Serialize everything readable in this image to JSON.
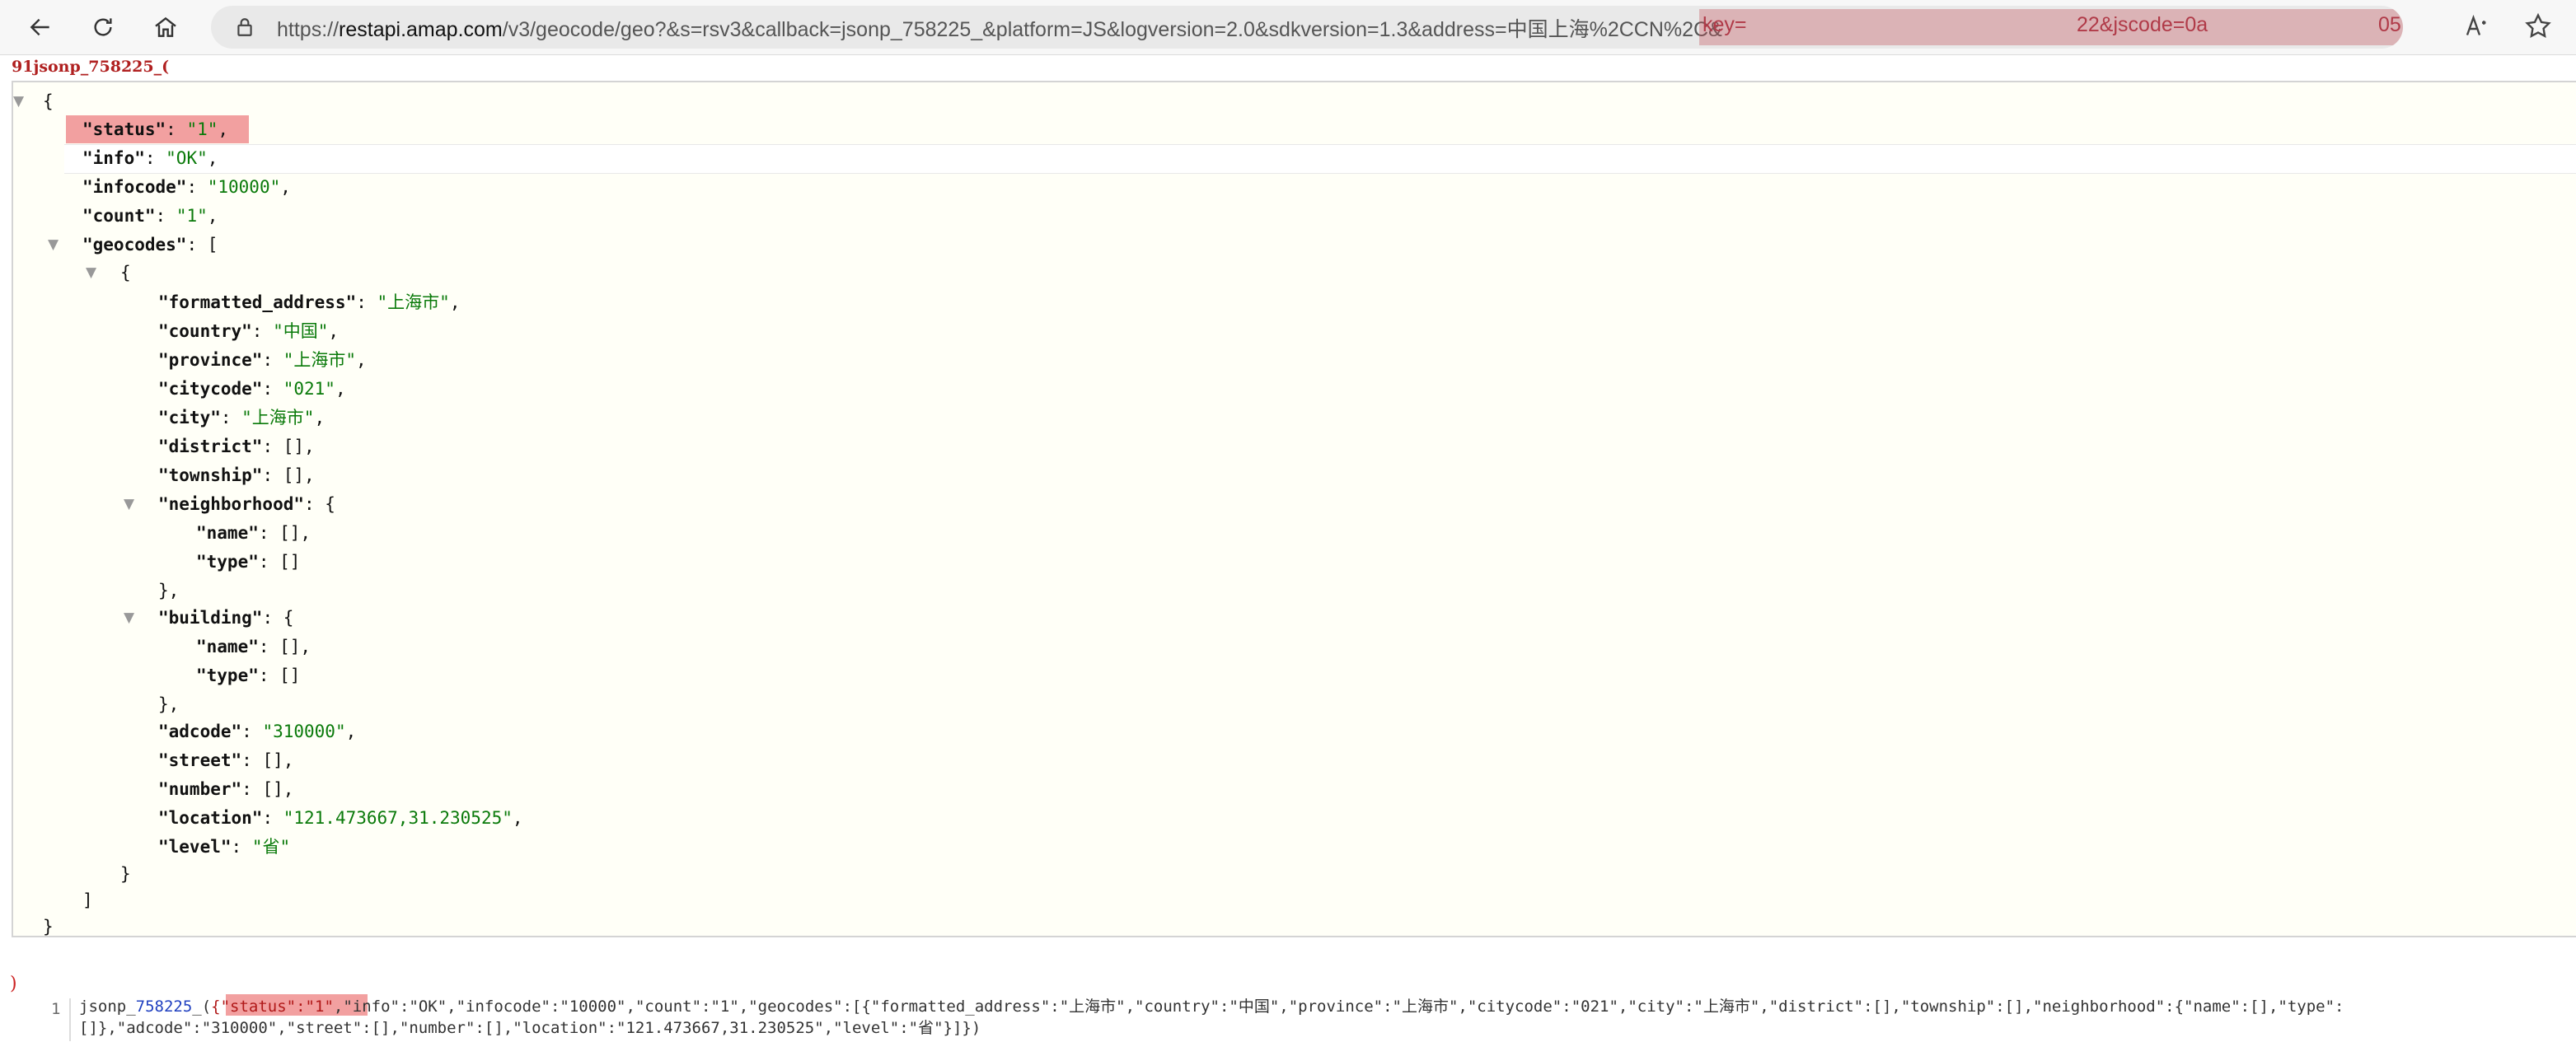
{
  "browser": {
    "url_prefix": "https://",
    "url_host": "restapi.amap.com",
    "url_path": "/v3/geocode/geo?&s=rsv3&callback=jsonp_758225_&platform=JS&logversion=2.0&sdkversion=1.3&address=中国上海%2CCN%2C&",
    "url_key": "key=",
    "url_key_tail": "22&jscode=0a",
    "url_end": "05..."
  },
  "prefix_text": "91jsonp_758225_(",
  "json": {
    "open_brace": "{",
    "status_key": "\"status\"",
    "status_val": "\"1\"",
    "info_key": "\"info\"",
    "info_val": "\"OK\"",
    "infocode_key": "\"infocode\"",
    "infocode_val": "\"10000\"",
    "count_key": "\"count\"",
    "count_val": "\"1\"",
    "geocodes_key": "\"geocodes\"",
    "formatted_address_key": "\"formatted_address\"",
    "formatted_address_val": "\"上海市\"",
    "country_key": "\"country\"",
    "country_val": "\"中国\"",
    "province_key": "\"province\"",
    "province_val": "\"上海市\"",
    "citycode_key": "\"citycode\"",
    "citycode_val": "\"021\"",
    "city_key": "\"city\"",
    "city_val": "\"上海市\"",
    "district_key": "\"district\"",
    "township_key": "\"township\"",
    "neighborhood_key": "\"neighborhood\"",
    "name_key": "\"name\"",
    "type_key": "\"type\"",
    "building_key": "\"building\"",
    "adcode_key": "\"adcode\"",
    "adcode_val": "\"310000\"",
    "street_key": "\"street\"",
    "number_key": "\"number\"",
    "location_key": "\"location\"",
    "location_val": "\"121.473667,31.230525\"",
    "level_key": "\"level\"",
    "level_val": "\"省\""
  },
  "close_paren": ")",
  "source": {
    "line_number": "1",
    "line1_a": "jsonp_",
    "line1_b": "758225",
    "line1_c": "_(",
    "line1_status": "{\"status\":\"1\"",
    "line1_rest": ",\"info\":\"OK\",\"infocode\":\"10000\",\"count\":\"1\",\"geocodes\":[{\"formatted_address\":\"上海市\",\"country\":\"中国\",\"province\":\"上海市\",\"citycode\":\"021\",\"city\":\"上海市\",\"district\":[],\"township\":[],\"neighborhood\":{\"name\":[],\"type\":",
    "line2": "[]},\"adcode\":\"310000\",\"street\":[],\"number\":[],\"location\":\"121.473667,31.230525\",\"level\":\"省\"}]})"
  }
}
